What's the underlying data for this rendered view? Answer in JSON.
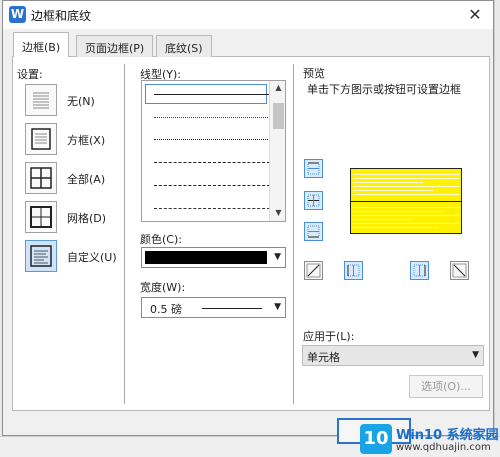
{
  "window": {
    "title": "边框和底纹",
    "app_icon_letter": "W",
    "close_glyph": "✕"
  },
  "tabs": [
    {
      "label": "边框(B)",
      "active": true
    },
    {
      "label": "页面边框(P)",
      "active": false
    },
    {
      "label": "底纹(S)",
      "active": false
    }
  ],
  "settings": {
    "label": "设置:",
    "items": [
      {
        "label": "无(N)",
        "icon": "none-border-icon",
        "selected": false
      },
      {
        "label": "方框(X)",
        "icon": "box-border-icon",
        "selected": false
      },
      {
        "label": "全部(A)",
        "icon": "all-borders-icon",
        "selected": false
      },
      {
        "label": "网格(D)",
        "icon": "grid-border-icon",
        "selected": false
      },
      {
        "label": "自定义(U)",
        "icon": "custom-border-icon",
        "selected": true
      }
    ]
  },
  "line_style": {
    "label": "线型(Y):",
    "selected_index": 0
  },
  "color": {
    "label": "颜色(C):",
    "value": "#000000"
  },
  "width": {
    "label": "宽度(W):",
    "value": "0.5 磅"
  },
  "preview": {
    "label": "预览",
    "hint": "单击下方图示或按钮可设置边框",
    "fill_color": "#fff200"
  },
  "apply_to": {
    "label": "应用于(L):",
    "value": "单元格"
  },
  "buttons": {
    "options": "选项(O)..."
  },
  "watermark": {
    "logo": "10",
    "title": "Win10 系统家园",
    "url": "www.qdhuajin.com"
  }
}
